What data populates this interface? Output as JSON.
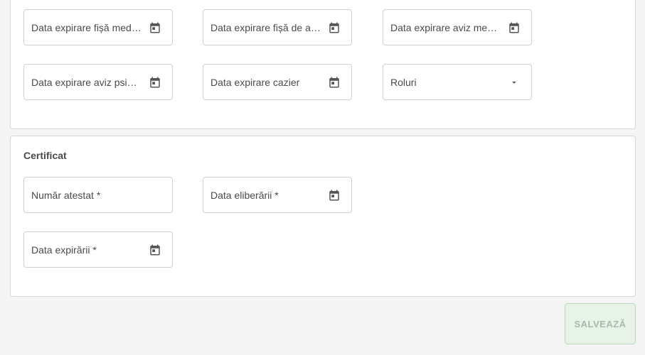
{
  "fields_top": [
    {
      "label": "Data expirare fișă medi…",
      "icon": "calendar-icon"
    },
    {
      "label": "Data expirare fișă de a…",
      "icon": "calendar-icon"
    },
    {
      "label": "Data expirare aviz medi…",
      "icon": "calendar-icon"
    },
    {
      "label": "Data expirare aviz psih…",
      "icon": "calendar-icon"
    },
    {
      "label": "Data expirare cazier",
      "icon": "calendar-icon"
    },
    {
      "label": "Roluri",
      "icon": "caret-down-icon"
    }
  ],
  "certificat": {
    "title": "Certificat",
    "fields": [
      {
        "label": "Număr atestat *"
      },
      {
        "label": "Data eliberării *",
        "icon": "calendar-icon"
      },
      {
        "label": "Data expirării *",
        "icon": "calendar-icon"
      }
    ]
  },
  "actions": {
    "save_label": "SALVEAZĂ"
  },
  "colors": {
    "icon": "#555555",
    "save_bg": "#e8f3e8",
    "save_text": "#a9b8a9"
  }
}
